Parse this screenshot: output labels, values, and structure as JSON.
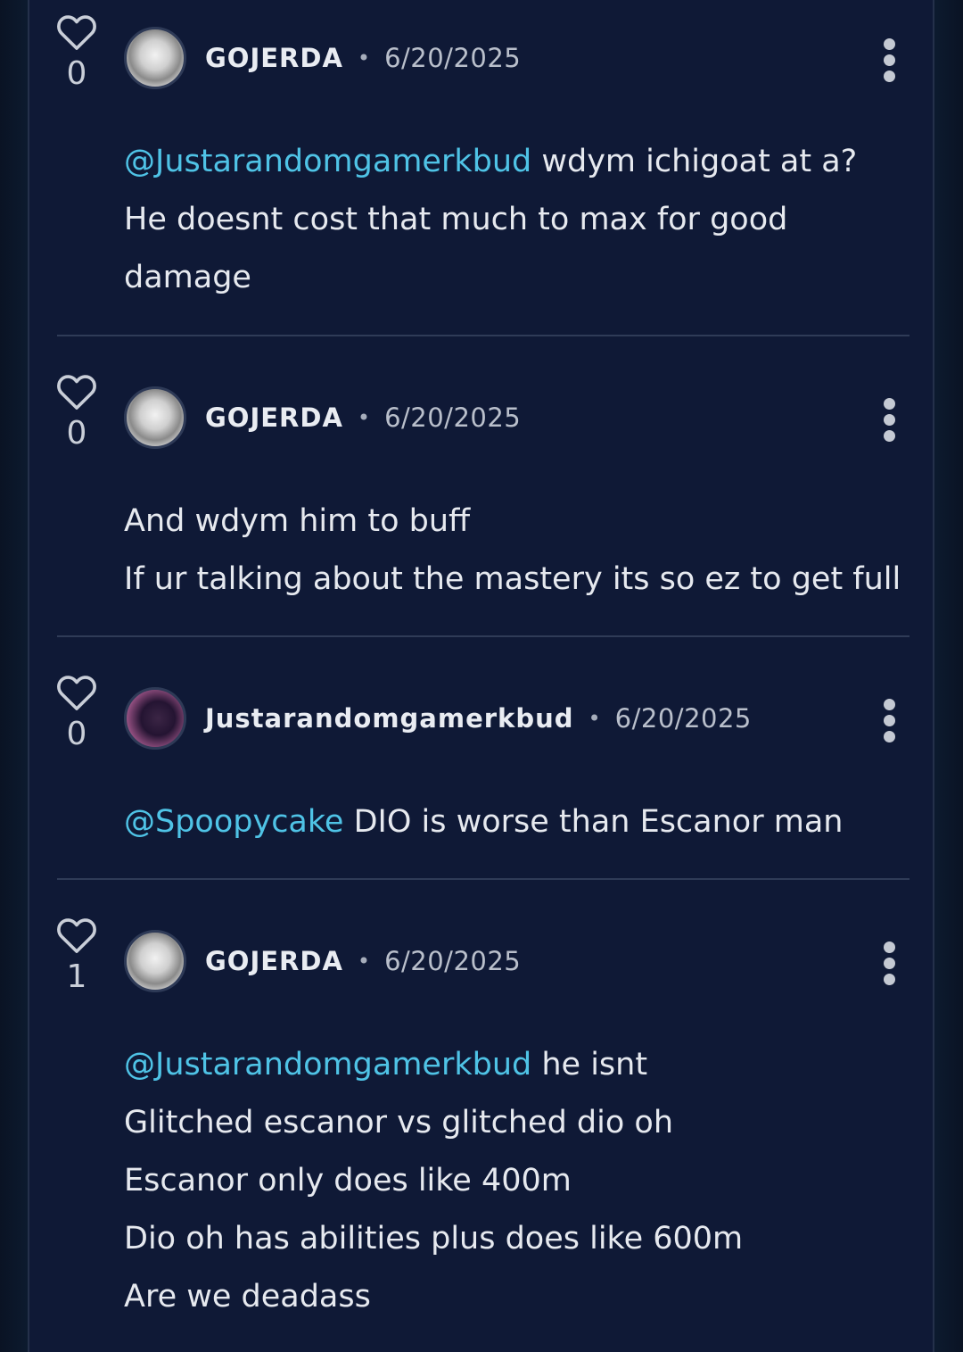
{
  "comments": [
    {
      "likes": "0",
      "username": "GOJERDA",
      "separator": "•",
      "date": "6/20/2025",
      "mention": "@Justarandomgamerkbud",
      "first_line_rest": " wdym ichigoat at a?",
      "lines": [
        "He doesnt cost that much to max for good",
        "damage"
      ]
    },
    {
      "likes": "0",
      "username": "GOJERDA",
      "separator": "•",
      "date": "6/20/2025",
      "lines": [
        "And wdym him to buff",
        "If ur talking about the mastery its so ez to get full"
      ]
    },
    {
      "likes": "0",
      "username": "Justarandomgamerkbud",
      "separator": "•",
      "date": "6/20/2025",
      "mention": "@Spoopycake",
      "first_line_rest": " DIO is worse than Escanor man"
    },
    {
      "likes": "1",
      "username": "GOJERDA",
      "separator": "•",
      "date": "6/20/2025",
      "mention": "@Justarandomgamerkbud",
      "first_line_rest": " he isnt",
      "lines": [
        "Glitched escanor vs glitched dio oh",
        "Escanor only does like 400m",
        "Dio oh has abilities plus does like 600m",
        "Are we deadass"
      ]
    }
  ],
  "icons": {
    "like": "heart-outline-icon",
    "more": "more-vertical-icon"
  },
  "colors": {
    "background": "#0f1936",
    "mention": "#4fc3e6",
    "text": "#e6e9ef",
    "divider": "#2f3b57"
  }
}
